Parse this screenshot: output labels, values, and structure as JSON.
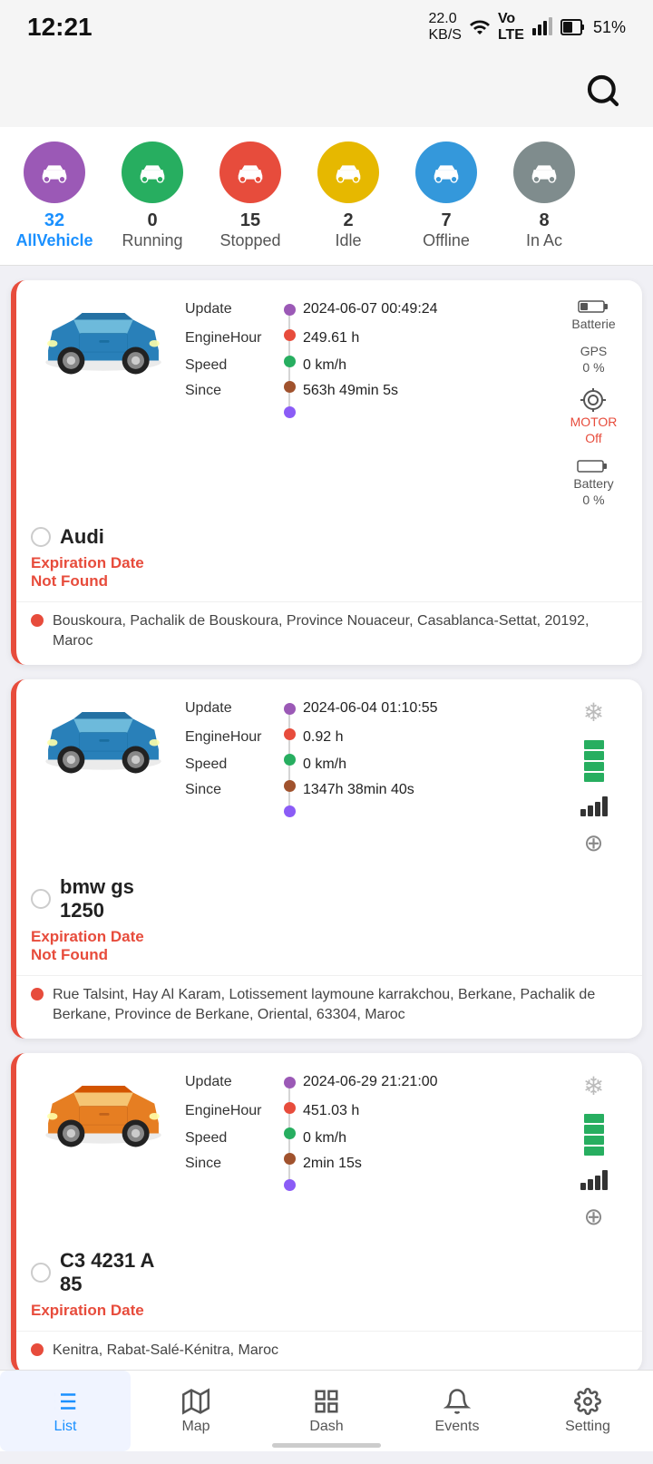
{
  "statusBar": {
    "time": "12:21",
    "network": "22.0 KB/S",
    "battery": "51%"
  },
  "filterTabs": [
    {
      "id": "all",
      "count": "32",
      "label": "AllVehicle",
      "color": "#9b59b6",
      "active": true
    },
    {
      "id": "running",
      "count": "0",
      "label": "Running",
      "color": "#27ae60",
      "active": false
    },
    {
      "id": "stopped",
      "count": "15",
      "label": "Stopped",
      "color": "#e74c3c",
      "active": false
    },
    {
      "id": "idle",
      "count": "2",
      "label": "Idle",
      "color": "#f1c40f",
      "active": false
    },
    {
      "id": "offline",
      "count": "7",
      "label": "Offline",
      "color": "#3498db",
      "active": false
    },
    {
      "id": "inac",
      "count": "8",
      "label": "In Ac",
      "color": "#7f8c8d",
      "active": false
    }
  ],
  "vehicles": [
    {
      "id": "audi",
      "name": "Audi",
      "carColor": "blue",
      "update": "2024-06-07\n00:49:24",
      "engineHour": "249.61 h",
      "speed": "0 km/h",
      "since": "563h 49min 5s",
      "batterie": "Batterie",
      "gps": "GPS",
      "gpsVal": "0 %",
      "motor": "MOTOR\nOff",
      "battery": "Battery",
      "batteryVal": "0 %",
      "expiryLabel": "Expiration Date\nNot Found",
      "address": "Bouskoura, Pachalik de Bouskoura, Province Nouaceur, Casablanca-Settat, 20192, Maroc"
    },
    {
      "id": "bmw",
      "name": "bmw gs\n1250",
      "carColor": "blue",
      "update": "2024-06-04\n01:10:55",
      "engineHour": "0.92 h",
      "speed": "0 km/h",
      "since": "1347h 38min\n40s",
      "expiryLabel": "Expiration Date\nNot Found",
      "address": "Rue Talsint, Hay Al Karam, Lotissement laymoune karrakchou, Berkane, Pachalik de Berkane, Province de Berkane, Oriental, 63304, Maroc"
    },
    {
      "id": "c3",
      "name": "C3 4231 A\n85",
      "carColor": "yellow",
      "update": "2024-06-29\n21:21:00",
      "engineHour": "451.03 h",
      "speed": "0 km/h",
      "since": "2min 15s",
      "expiryLabel": "Expiration Date",
      "address": "Kenitra, Rabat-Salé-Kénitra, Maroc"
    }
  ],
  "bottomNav": [
    {
      "id": "list",
      "label": "List",
      "active": true
    },
    {
      "id": "map",
      "label": "Map",
      "active": false
    },
    {
      "id": "dash",
      "label": "Dash",
      "active": false
    },
    {
      "id": "events",
      "label": "Events",
      "active": false
    },
    {
      "id": "setting",
      "label": "Setting",
      "active": false
    }
  ]
}
